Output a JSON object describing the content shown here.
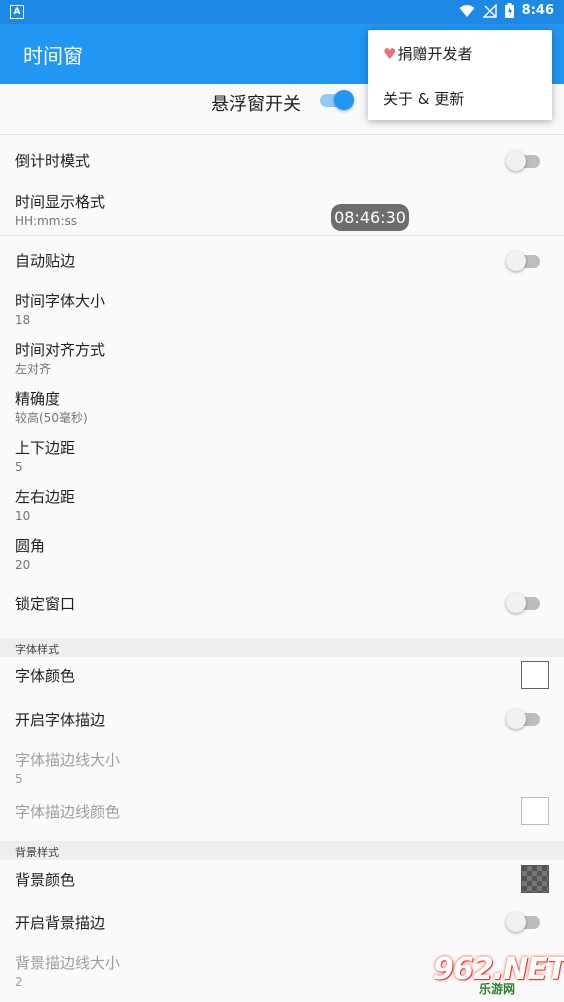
{
  "status_bar": {
    "indicator": "A",
    "icons": [
      "wifi-icon",
      "no-signal-icon",
      "battery-icon"
    ],
    "time": "8:46"
  },
  "app_bar": {
    "title": "时间窗"
  },
  "master": {
    "label": "悬浮窗开关",
    "enabled": true
  },
  "overflow_menu": {
    "items": [
      {
        "icon": "heart-icon",
        "label": "捐赠开发者"
      },
      {
        "label": "关于 & 更新"
      }
    ]
  },
  "floating_clock": {
    "text": "08:46:30"
  },
  "prefs": [
    {
      "title": "倒计时模式",
      "switch": false
    },
    {
      "title": "时间显示格式",
      "summary": "HH:mm:ss"
    },
    {
      "title": "自动贴边",
      "switch": false
    },
    {
      "title": "时间字体大小",
      "summary": "18"
    },
    {
      "title": "时间对齐方式",
      "summary": "左对齐"
    },
    {
      "title": "精确度",
      "summary": "较高(50毫秒)"
    },
    {
      "title": "上下边距",
      "summary": "5"
    },
    {
      "title": "左右边距",
      "summary": "10"
    },
    {
      "title": "圆角",
      "summary": "20"
    },
    {
      "title": "锁定窗口",
      "switch": false
    }
  ],
  "font_style": {
    "header": "字体样式",
    "color_title": "字体颜色",
    "color_value": "#ffffff",
    "stroke_title": "开启字体描边",
    "stroke_switch": false,
    "stroke_size_title": "字体描边线大小",
    "stroke_size_value": "5",
    "stroke_color_title": "字体描边线颜色",
    "stroke_color_value": "#ffffff"
  },
  "bg_style": {
    "header": "背景样式",
    "color_title": "背景颜色",
    "stroke_title": "开启背景描边",
    "stroke_switch": false,
    "stroke_size_title": "背景描边线大小",
    "stroke_size_value": "2"
  },
  "watermark": {
    "text": "962.NET",
    "sub": "乐游网"
  },
  "colors": {
    "primary": "#2196f3",
    "status_bar": "#1e88e5",
    "accent": "#2196f3"
  }
}
